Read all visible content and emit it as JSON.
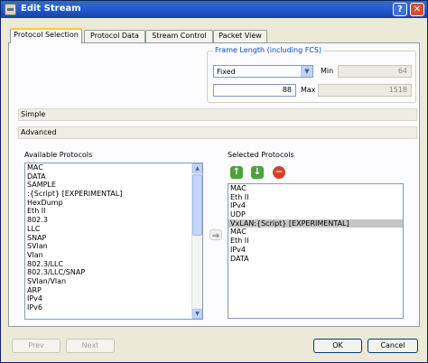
{
  "window": {
    "title": "Edit Stream",
    "help_btn": "?",
    "close_btn": "✕"
  },
  "tabs": [
    {
      "label": "Protocol Selection"
    },
    {
      "label": "Protocol Data"
    },
    {
      "label": "Stream Control"
    },
    {
      "label": "Packet View"
    }
  ],
  "frame_length": {
    "legend": "Frame Length (including FCS)",
    "mode": "Fixed",
    "min_label": "Min",
    "min_value": "64",
    "value": "88",
    "max_label": "Max",
    "max_value": "1518"
  },
  "sections": {
    "simple": "Simple",
    "advanced": "Advanced"
  },
  "available": {
    "label": "Available Protocols",
    "items": [
      "MAC",
      "DATA",
      "SAMPLE",
      ":{Script} [EXPERIMENTAL]",
      "HexDump",
      "Eth II",
      "802.3",
      "LLC",
      "SNAP",
      "SVlan",
      "Vlan",
      "802.3/LLC",
      "802.3/LLC/SNAP",
      "SVlan/Vlan",
      "ARP",
      "IPv4",
      "IPv6"
    ]
  },
  "selected": {
    "label": "Selected Protocols",
    "items": [
      "MAC",
      "Eth II",
      "IPv4",
      "UDP",
      "VxLAN:{Script} [EXPERIMENTAL]",
      "MAC",
      "Eth II",
      "IPv4",
      "DATA"
    ],
    "highlighted_index": 4
  },
  "icons": {
    "up": "↑",
    "down": "↓",
    "remove": "−",
    "move_right": "⇒"
  },
  "colors": {
    "up_down": "#4aa43a",
    "remove": "#d6402a"
  },
  "footer": {
    "prev": "Prev",
    "next": "Next",
    "ok": "OK",
    "cancel": "Cancel"
  }
}
